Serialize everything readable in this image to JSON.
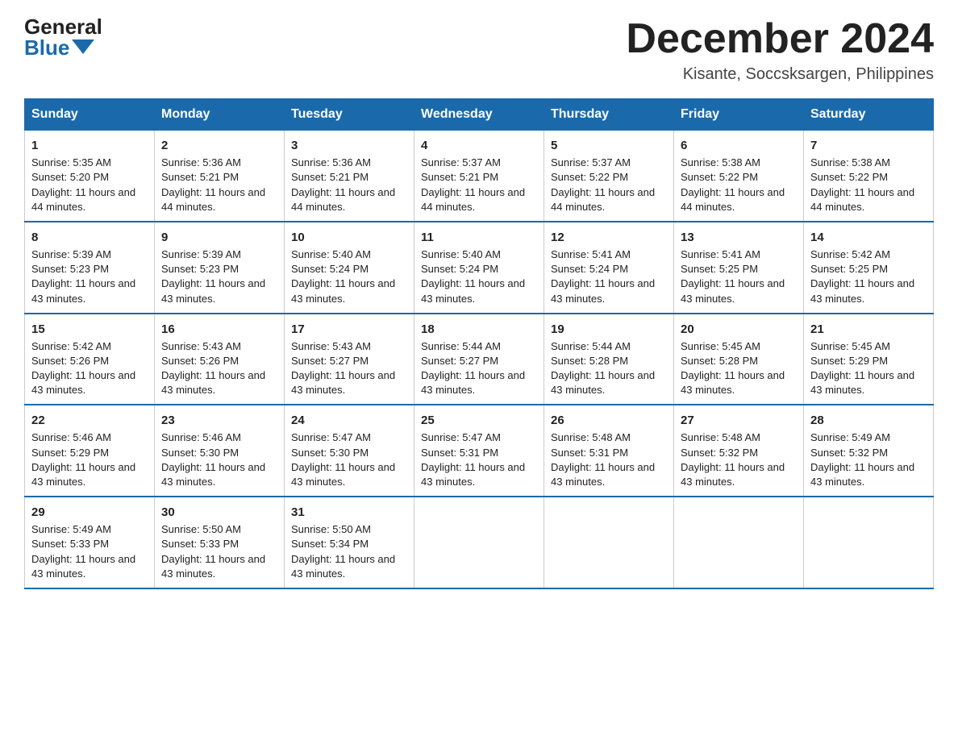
{
  "header": {
    "logo_general": "General",
    "logo_blue": "Blue",
    "month_title": "December 2024",
    "location": "Kisante, Soccsksargen, Philippines"
  },
  "days_of_week": [
    "Sunday",
    "Monday",
    "Tuesday",
    "Wednesday",
    "Thursday",
    "Friday",
    "Saturday"
  ],
  "weeks": [
    [
      {
        "day": "1",
        "sunrise": "5:35 AM",
        "sunset": "5:20 PM",
        "daylight": "11 hours and 44 minutes."
      },
      {
        "day": "2",
        "sunrise": "5:36 AM",
        "sunset": "5:21 PM",
        "daylight": "11 hours and 44 minutes."
      },
      {
        "day": "3",
        "sunrise": "5:36 AM",
        "sunset": "5:21 PM",
        "daylight": "11 hours and 44 minutes."
      },
      {
        "day": "4",
        "sunrise": "5:37 AM",
        "sunset": "5:21 PM",
        "daylight": "11 hours and 44 minutes."
      },
      {
        "day": "5",
        "sunrise": "5:37 AM",
        "sunset": "5:22 PM",
        "daylight": "11 hours and 44 minutes."
      },
      {
        "day": "6",
        "sunrise": "5:38 AM",
        "sunset": "5:22 PM",
        "daylight": "11 hours and 44 minutes."
      },
      {
        "day": "7",
        "sunrise": "5:38 AM",
        "sunset": "5:22 PM",
        "daylight": "11 hours and 44 minutes."
      }
    ],
    [
      {
        "day": "8",
        "sunrise": "5:39 AM",
        "sunset": "5:23 PM",
        "daylight": "11 hours and 43 minutes."
      },
      {
        "day": "9",
        "sunrise": "5:39 AM",
        "sunset": "5:23 PM",
        "daylight": "11 hours and 43 minutes."
      },
      {
        "day": "10",
        "sunrise": "5:40 AM",
        "sunset": "5:24 PM",
        "daylight": "11 hours and 43 minutes."
      },
      {
        "day": "11",
        "sunrise": "5:40 AM",
        "sunset": "5:24 PM",
        "daylight": "11 hours and 43 minutes."
      },
      {
        "day": "12",
        "sunrise": "5:41 AM",
        "sunset": "5:24 PM",
        "daylight": "11 hours and 43 minutes."
      },
      {
        "day": "13",
        "sunrise": "5:41 AM",
        "sunset": "5:25 PM",
        "daylight": "11 hours and 43 minutes."
      },
      {
        "day": "14",
        "sunrise": "5:42 AM",
        "sunset": "5:25 PM",
        "daylight": "11 hours and 43 minutes."
      }
    ],
    [
      {
        "day": "15",
        "sunrise": "5:42 AM",
        "sunset": "5:26 PM",
        "daylight": "11 hours and 43 minutes."
      },
      {
        "day": "16",
        "sunrise": "5:43 AM",
        "sunset": "5:26 PM",
        "daylight": "11 hours and 43 minutes."
      },
      {
        "day": "17",
        "sunrise": "5:43 AM",
        "sunset": "5:27 PM",
        "daylight": "11 hours and 43 minutes."
      },
      {
        "day": "18",
        "sunrise": "5:44 AM",
        "sunset": "5:27 PM",
        "daylight": "11 hours and 43 minutes."
      },
      {
        "day": "19",
        "sunrise": "5:44 AM",
        "sunset": "5:28 PM",
        "daylight": "11 hours and 43 minutes."
      },
      {
        "day": "20",
        "sunrise": "5:45 AM",
        "sunset": "5:28 PM",
        "daylight": "11 hours and 43 minutes."
      },
      {
        "day": "21",
        "sunrise": "5:45 AM",
        "sunset": "5:29 PM",
        "daylight": "11 hours and 43 minutes."
      }
    ],
    [
      {
        "day": "22",
        "sunrise": "5:46 AM",
        "sunset": "5:29 PM",
        "daylight": "11 hours and 43 minutes."
      },
      {
        "day": "23",
        "sunrise": "5:46 AM",
        "sunset": "5:30 PM",
        "daylight": "11 hours and 43 minutes."
      },
      {
        "day": "24",
        "sunrise": "5:47 AM",
        "sunset": "5:30 PM",
        "daylight": "11 hours and 43 minutes."
      },
      {
        "day": "25",
        "sunrise": "5:47 AM",
        "sunset": "5:31 PM",
        "daylight": "11 hours and 43 minutes."
      },
      {
        "day": "26",
        "sunrise": "5:48 AM",
        "sunset": "5:31 PM",
        "daylight": "11 hours and 43 minutes."
      },
      {
        "day": "27",
        "sunrise": "5:48 AM",
        "sunset": "5:32 PM",
        "daylight": "11 hours and 43 minutes."
      },
      {
        "day": "28",
        "sunrise": "5:49 AM",
        "sunset": "5:32 PM",
        "daylight": "11 hours and 43 minutes."
      }
    ],
    [
      {
        "day": "29",
        "sunrise": "5:49 AM",
        "sunset": "5:33 PM",
        "daylight": "11 hours and 43 minutes."
      },
      {
        "day": "30",
        "sunrise": "5:50 AM",
        "sunset": "5:33 PM",
        "daylight": "11 hours and 43 minutes."
      },
      {
        "day": "31",
        "sunrise": "5:50 AM",
        "sunset": "5:34 PM",
        "daylight": "11 hours and 43 minutes."
      },
      null,
      null,
      null,
      null
    ]
  ],
  "labels": {
    "sunrise_prefix": "Sunrise: ",
    "sunset_prefix": "Sunset: ",
    "daylight_prefix": "Daylight: "
  }
}
